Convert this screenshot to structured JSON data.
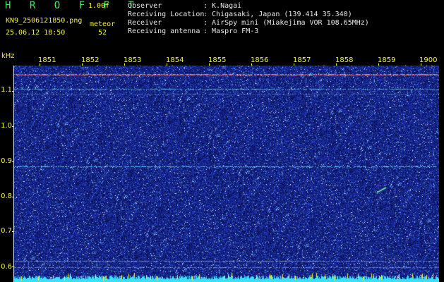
{
  "header": {
    "app_title": "H R O F F T",
    "version": "1.00f",
    "filename": "KN9_2506121850.png",
    "meteor_label": "meteor",
    "datetime": "25.06.12 18:50",
    "meteor_count": "52"
  },
  "meta": [
    {
      "label": "Observer",
      "value": ": K.Nagai"
    },
    {
      "label": "Receiving Location",
      "value": ": Chigasaki, Japan (139.414 35.340)"
    },
    {
      "label": "Receiver",
      "value": ": AirSpy mini (Miakejima VOR 108.65MHz)"
    },
    {
      "label": "Receiving antenna",
      "value": ": Maspro FM-3"
    }
  ],
  "spectrogram": {
    "y_unit": "kHz",
    "y_ticks": [
      "1.1",
      "1.0",
      "0.9",
      "0.8",
      "0.7",
      "0.6"
    ],
    "x_ticks": [
      "1851",
      "1852",
      "1853",
      "1854",
      "1855",
      "1856",
      "1857",
      "1858",
      "1859",
      "1900"
    ],
    "colors": {
      "background": "#1a2a90",
      "axis": "#f3f33a",
      "header_green": "#45e65f"
    }
  }
}
